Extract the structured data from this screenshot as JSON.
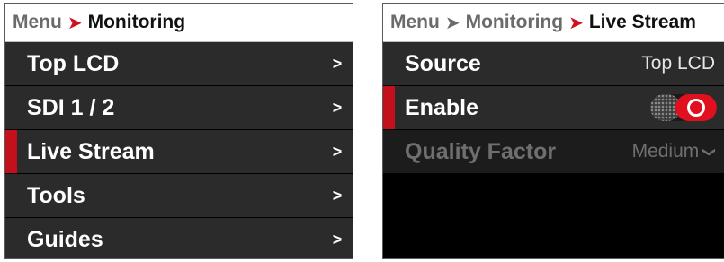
{
  "left_panel": {
    "breadcrumb": {
      "items": [
        "Menu",
        "Monitoring"
      ],
      "separator": "➤"
    },
    "menu_items": [
      {
        "label": "Top LCD",
        "chevron": ">"
      },
      {
        "label": "SDI 1 / 2",
        "chevron": ">"
      },
      {
        "label": "Live Stream",
        "chevron": ">",
        "selected": true
      },
      {
        "label": "Tools",
        "chevron": ">"
      },
      {
        "label": "Guides",
        "chevron": ">"
      }
    ]
  },
  "right_panel": {
    "breadcrumb": {
      "items": [
        "Menu",
        "Monitoring",
        "Live Stream"
      ],
      "separator": "➤"
    },
    "settings": {
      "source": {
        "label": "Source",
        "value": "Top LCD"
      },
      "enable": {
        "label": "Enable",
        "state": "on",
        "selected": true
      },
      "quality": {
        "label": "Quality Factor",
        "value": "Medium",
        "caret": "❯",
        "disabled": true
      }
    }
  },
  "colors": {
    "accent_red": "#d10f1e",
    "selection_bar": "#c40f1c",
    "row_bg": "#2b2b2b",
    "disabled_text": "#6f6f6f"
  }
}
